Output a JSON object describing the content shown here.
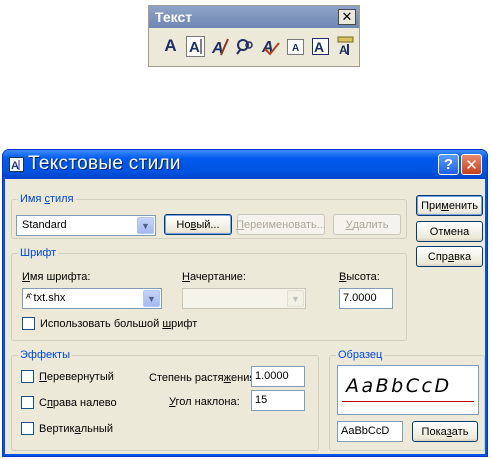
{
  "toolbar": {
    "title": "Текст",
    "close": "✕",
    "icons": [
      "text-icon",
      "text-edit-icon",
      "text-style-icon",
      "find-icon",
      "spellcheck-icon",
      "text-scale-icon",
      "text-justify-icon",
      "text-convert-icon"
    ]
  },
  "dialog": {
    "title": "Текстовые стили",
    "help": "?",
    "close": "✕",
    "style_group": {
      "label_pre": "Имя ",
      "label_u": "с",
      "label_post": "тиля",
      "selected": "Standard",
      "new_pre": "Но",
      "new_u": "в",
      "new_post": "ый...",
      "rename_pre": "",
      "rename_u": "П",
      "rename_post": "ереименовать...",
      "delete_pre": "",
      "delete_u": "У",
      "delete_post": "далить"
    },
    "font_group": {
      "label": "Шрифт",
      "font_name_pre": "",
      "font_name_u": "И",
      "font_name_post": "мя шрифта:",
      "font_value": "txt.shx",
      "style_pre": "",
      "style_u": "Н",
      "style_post": "ачертание:",
      "style_value": "",
      "height_pre": "",
      "height_u": "В",
      "height_post": "ысота:",
      "height_value": "7.0000",
      "bigfont_pre": "Использовать большой ",
      "bigfont_u": "ш",
      "bigfont_post": "рифт"
    },
    "effects_group": {
      "label": "Эффекты",
      "upside_pre": "",
      "upside_u": "П",
      "upside_post": "еревернутый",
      "backwards_pre": "С",
      "backwards_u": "п",
      "backwards_post": "рава налево",
      "vertical_pre": "Вертик",
      "vertical_u": "а",
      "vertical_post": "льный",
      "width_pre": "Степень растя",
      "width_u": "ж",
      "width_post": "ения:",
      "width_value": "1.0000",
      "oblique_pre": "",
      "oblique_u": "У",
      "oblique_post": "гол наклона:",
      "oblique_value": "15"
    },
    "preview_group": {
      "label": "Образец",
      "sample": "AaBbCcD",
      "input_value": "AaBbCcD",
      "show_pre": "Пока",
      "show_u": "з",
      "show_post": "ать"
    },
    "buttons": {
      "apply_pre": "При",
      "apply_u": "м",
      "apply_post": "енить",
      "cancel": "Отмена",
      "help_pre": "Спр",
      "help_u": "а",
      "help_post": "вка"
    }
  }
}
